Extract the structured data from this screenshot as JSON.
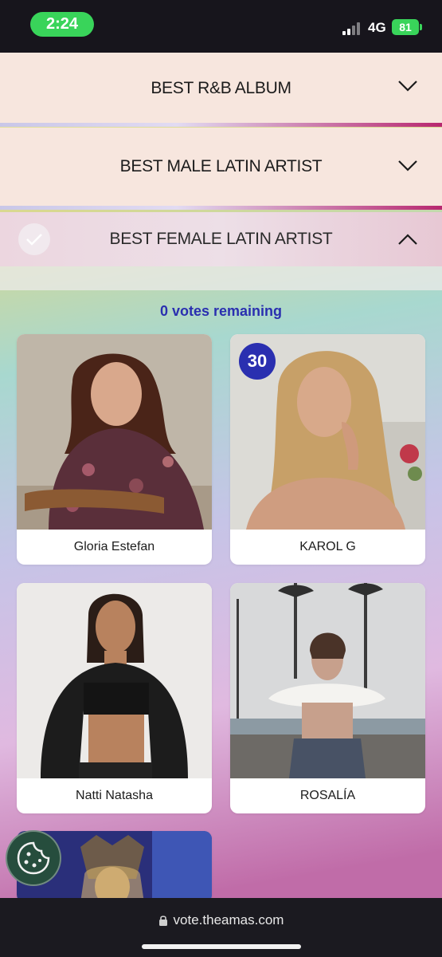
{
  "status_bar": {
    "time": "2:24",
    "network": "4G",
    "battery": "81"
  },
  "categories": [
    {
      "title": "BEST R&B ALBUM",
      "expanded": false
    },
    {
      "title": "BEST MALE LATIN ARTIST",
      "expanded": false
    },
    {
      "title": "BEST FEMALE LATIN ARTIST",
      "expanded": true
    }
  ],
  "votes_remaining": "0 votes remaining",
  "nominees": [
    {
      "name": "Gloria Estefan"
    },
    {
      "name": "KAROL G",
      "badge": "30"
    },
    {
      "name": "Natti Natasha"
    },
    {
      "name": "ROSALÍA"
    }
  ],
  "browser": {
    "url": "vote.theamas.com"
  },
  "colors": {
    "accent": "#2a2fb0",
    "status_green": "#39d45a",
    "accordion_bg": "#f7e6de"
  },
  "icons": [
    "chevron-down-icon",
    "chevron-up-icon",
    "checkmark-icon",
    "cookie-icon",
    "lock-icon"
  ]
}
